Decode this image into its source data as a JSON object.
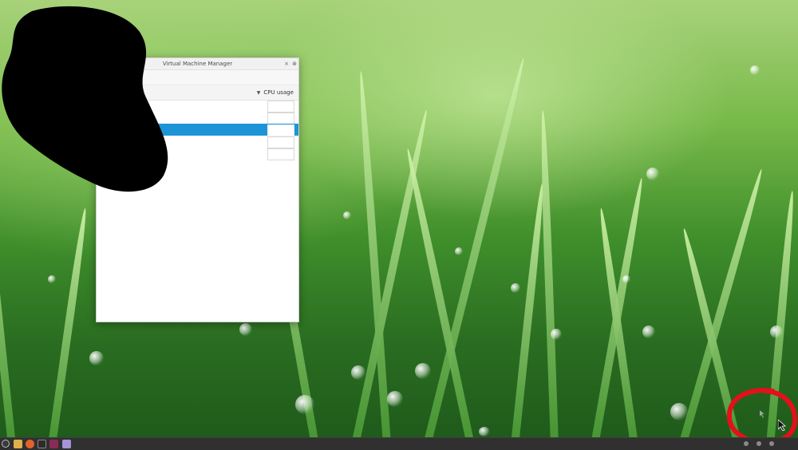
{
  "window": {
    "title": "Virtual Machine Manager",
    "minimize_glyph": "×",
    "close_glyph": "⊗",
    "column_header": "CPU usage",
    "sort_icon": "chevron-down-icon",
    "rows": [
      {
        "name": "",
        "selected": false
      },
      {
        "name": "",
        "selected": false
      },
      {
        "name": "",
        "selected": true
      },
      {
        "name": "",
        "selected": false
      },
      {
        "name": "",
        "selected": false
      }
    ]
  },
  "taskbar": {
    "items": [
      "menu-icon",
      "files-icon",
      "firefox-icon",
      "terminal-icon",
      "virt-manager-icon",
      "app-icon"
    ]
  },
  "colors": {
    "selection": "#1d94d6",
    "taskbar": "#303030",
    "annotation": "#e5101a"
  }
}
